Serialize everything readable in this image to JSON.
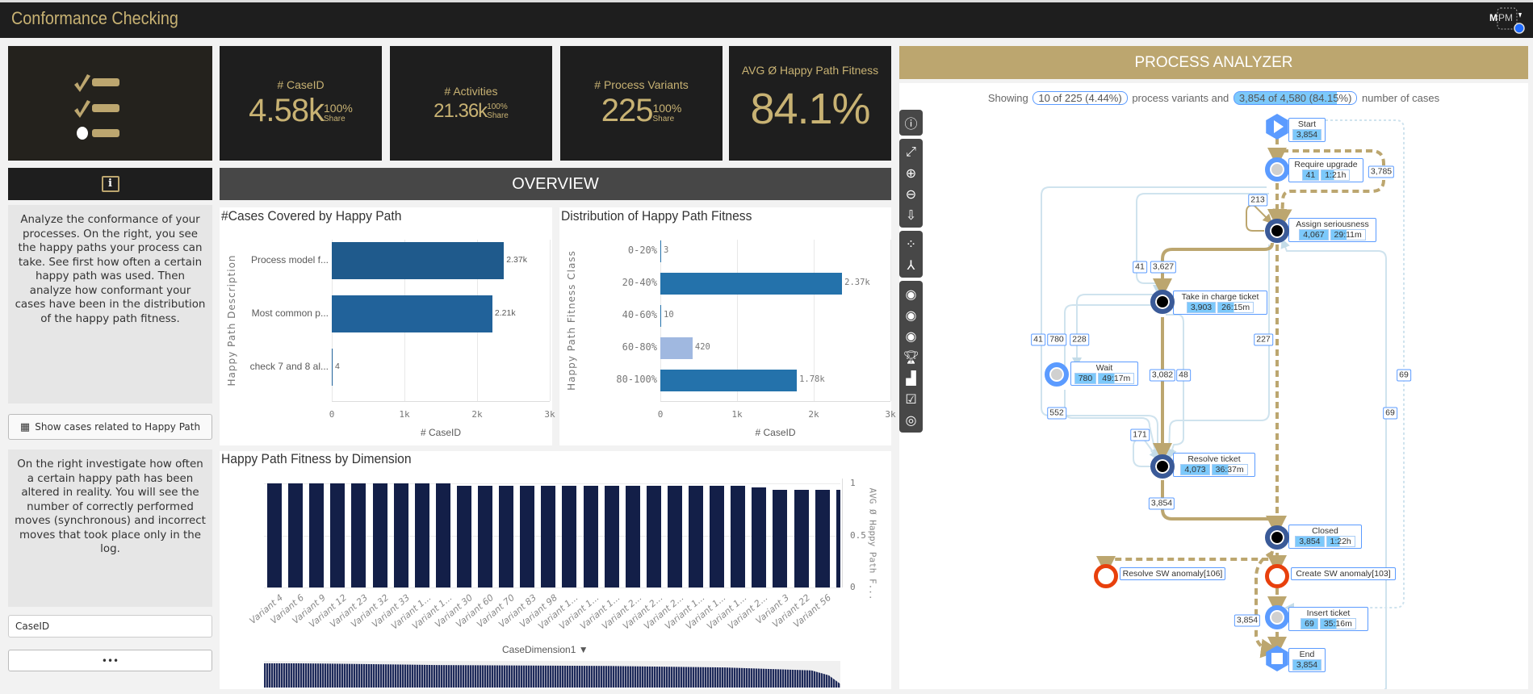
{
  "app": {
    "title": "Conformance Checking",
    "logo_text": "MPM"
  },
  "kpis": [
    {
      "label": "# CaseID",
      "value": "4.58k",
      "share": "100%",
      "share_label": "Share"
    },
    {
      "label": "# Activities",
      "value": "21.36k",
      "share": "100%",
      "share_label": "Share"
    },
    {
      "label": "# Process Variants",
      "value": "225",
      "share": "100%",
      "share_label": "Share"
    },
    {
      "label": "AVG Ø Happy Path Fitness",
      "value": "84.1%"
    }
  ],
  "left": {
    "info_icon": "info-icon",
    "text1": "Analyze the conformance of your processes. On the right, you see the happy paths your process can take. See first how often a certain happy path was used. Then analyze how conformant your cases have been in the distribution of the happy path fitness.",
    "button_label": "Show cases related to Happy Path",
    "text2": "On the right investigate how often a certain happy path has been altered in reality. You will see the number of correctly performed moves (synchronous) and incorrect moves that took place only in the log.",
    "field_label": "CaseID",
    "more_label": "•••"
  },
  "overview": {
    "title": "OVERVIEW"
  },
  "chart_data": [
    {
      "type": "bar",
      "orientation": "horizontal",
      "title": "#Cases Covered by Happy Path",
      "categories": [
        "Process model f...",
        "Most common p...",
        "check 7 and 8 al..."
      ],
      "values": [
        2370,
        2210,
        4
      ],
      "data_labels": [
        "2.37k",
        "2.21k",
        "4"
      ],
      "xlabel": "# CaseID",
      "ylabel": "Happy Path Description",
      "xlim": [
        0,
        3000
      ],
      "xticks": [
        "0",
        "1k",
        "2k",
        "3k"
      ],
      "grid": true,
      "colors": [
        "#1f5a8c",
        "#21629a",
        "#21629a"
      ]
    },
    {
      "type": "bar",
      "orientation": "horizontal",
      "title": "Distribution of Happy Path Fitness",
      "categories": [
        "0-20%",
        "20-40%",
        "40-60%",
        "60-80%",
        "80-100%"
      ],
      "values": [
        3,
        2370,
        10,
        420,
        1780
      ],
      "data_labels": [
        "3",
        "2.37k",
        "10",
        "420",
        "1.78k"
      ],
      "xlabel": "# CaseID",
      "ylabel": "Happy Path Fitness Class",
      "xlim": [
        0,
        3000
      ],
      "xticks": [
        "0",
        "1k",
        "2k",
        "3k"
      ],
      "grid": true,
      "colors": [
        "#2472ab",
        "#2472ab",
        "#2472ab",
        "#a0b8e0",
        "#2472ab"
      ]
    },
    {
      "type": "bar",
      "title": "Happy Path Fitness by Dimension",
      "categories": [
        "Variant 4",
        "Variant 6",
        "Variant 9",
        "Variant 12",
        "Variant 23",
        "Variant 32",
        "Variant 33",
        "Variant 1...",
        "Variant 1...",
        "Variant 30",
        "Variant 60",
        "Variant 70",
        "Variant 83",
        "Variant 98",
        "Variant 1...",
        "Variant 1...",
        "Variant 1...",
        "Variant 2...",
        "Variant 2...",
        "Variant 2...",
        "Variant 1...",
        "Variant 1...",
        "Variant 1...",
        "Variant 2...",
        "Variant 3",
        "Variant 22",
        "Variant 56",
        ""
      ],
      "values": [
        1.0,
        1.0,
        1.0,
        1.0,
        1.0,
        1.0,
        1.0,
        1.0,
        1.0,
        0.98,
        0.98,
        0.98,
        0.98,
        0.98,
        0.98,
        0.98,
        0.98,
        0.98,
        0.98,
        0.98,
        0.98,
        0.98,
        0.98,
        0.96,
        0.94,
        0.94,
        0.94,
        0.94
      ],
      "ylabel": "AVG Ø Happy Path F...",
      "xlabel": "CaseDimension1",
      "ylim": [
        0,
        1
      ],
      "yticks": [
        "0",
        "0.5",
        "1"
      ],
      "grid": true,
      "color": "#131f48"
    }
  ],
  "process": {
    "header": "PROCESS ANALYZER",
    "showing": "Showing",
    "variants_pill": "10 of 225 (4.44%)",
    "mid_text": "process variants and",
    "cases_pill": "3,854 of 4,580 (84.15%)",
    "end_text": "number of cases",
    "toolbar": [
      "info-icon",
      "fit-view-icon",
      "zoom-in-icon",
      "zoom-out-icon",
      "download-svg-icon",
      "nodes-icon",
      "branch-icon",
      "eye-plus-icon",
      "eye-minus-icon",
      "eye-all-icon",
      "trophy-icon",
      "podium-icon",
      "checkbox-icon",
      "target-icon"
    ],
    "nodes": [
      {
        "name": "Start",
        "count": "3,854",
        "type": "start"
      },
      {
        "name": "Require upgrade",
        "count": "41",
        "duration": "1:21h",
        "type": "light"
      },
      {
        "name": "Assign seriousness",
        "count": "4,067",
        "duration": "29:11m",
        "type": "main"
      },
      {
        "name": "Take in charge ticket",
        "count": "3,903",
        "duration": "26:15m",
        "type": "main"
      },
      {
        "name": "Wait",
        "count": "780",
        "duration": "49:17m",
        "type": "light"
      },
      {
        "name": "Resolve ticket",
        "count": "4,073",
        "duration": "36:37m",
        "type": "main"
      },
      {
        "name": "Closed",
        "count": "3,854",
        "duration": "1:22h",
        "type": "main"
      },
      {
        "name": "Resolve SW anomaly[106]",
        "type": "missing"
      },
      {
        "name": "Create SW anomaly[103]",
        "type": "missing"
      },
      {
        "name": "Insert ticket",
        "count": "69",
        "duration": "35:16m",
        "type": "light"
      },
      {
        "name": "End",
        "count": "3,854",
        "type": "end"
      }
    ],
    "edge_labels": [
      "213",
      "3,785",
      "41",
      "3,627",
      "41",
      "780",
      "228",
      "227",
      "3,082",
      "48",
      "69",
      "552",
      "69",
      "171",
      "3,854",
      "3,854"
    ],
    "colors": {
      "happy": "#bca66f",
      "other": "#cfe3ee",
      "missing": "#e8400c",
      "node": "#3a5a98"
    }
  }
}
